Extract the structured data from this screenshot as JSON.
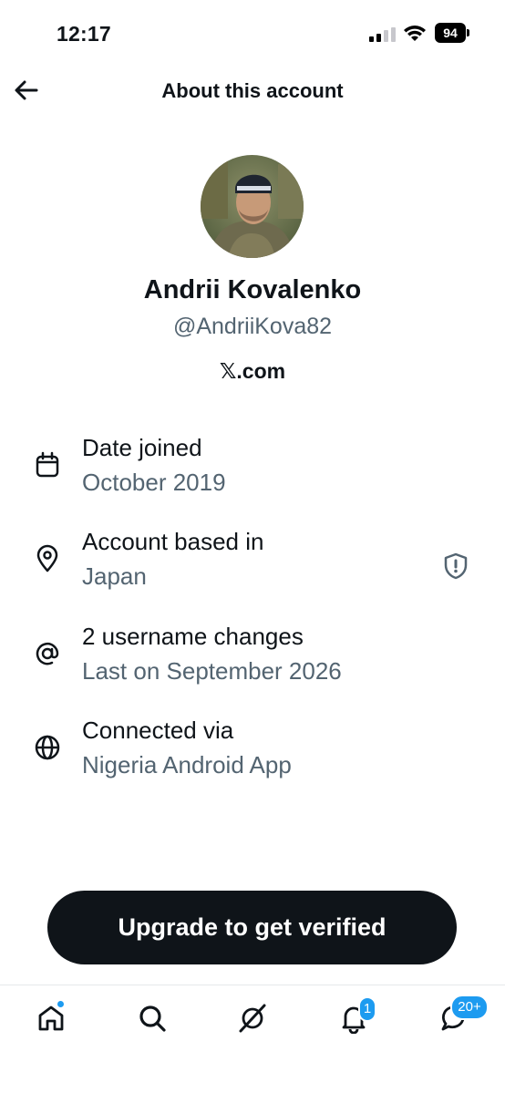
{
  "status_bar": {
    "time": "12:17",
    "battery": "94"
  },
  "header": {
    "title": "About this account",
    "back_icon": "arrow-left-icon"
  },
  "profile": {
    "name": "Andrii Kovalenko",
    "handle": "@AndriiKova82",
    "site_logo": "𝕏",
    "site_suffix": ".com"
  },
  "info": [
    {
      "icon": "calendar-icon",
      "label": "Date joined",
      "value": "October 2019"
    },
    {
      "icon": "location-pin-icon",
      "label": "Account based in",
      "value": "Japan"
    },
    {
      "icon": "at-sign-icon",
      "label": "2 username changes",
      "value": "Last on September 2026"
    },
    {
      "icon": "globe-icon",
      "label": "Connected via",
      "value": "Nigeria Android App"
    }
  ],
  "upgrade_button": {
    "label": "Upgrade to get verified"
  },
  "bottom_nav": {
    "items": [
      "home-icon",
      "search-icon",
      "grok-icon",
      "notifications-icon",
      "messages-icon"
    ],
    "notifications_badge": "1",
    "messages_badge": "20+"
  },
  "colors": {
    "primary_text": "#0f1419",
    "secondary_text": "#536471",
    "accent": "#1d9bf0"
  }
}
